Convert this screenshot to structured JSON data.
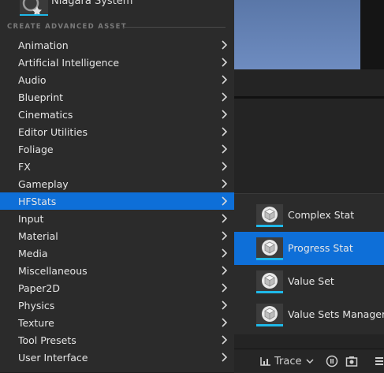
{
  "top_item": {
    "label": "Niagara System"
  },
  "section": {
    "header": "CREATE ADVANCED ASSET"
  },
  "menu_items": [
    {
      "label": "Animation"
    },
    {
      "label": "Artificial Intelligence"
    },
    {
      "label": "Audio"
    },
    {
      "label": "Blueprint"
    },
    {
      "label": "Cinematics"
    },
    {
      "label": "Editor Utilities"
    },
    {
      "label": "Foliage"
    },
    {
      "label": "FX"
    },
    {
      "label": "Gameplay"
    },
    {
      "label": "HFStats",
      "selected": true
    },
    {
      "label": "Input"
    },
    {
      "label": "Material"
    },
    {
      "label": "Media"
    },
    {
      "label": "Miscellaneous"
    },
    {
      "label": "Paper2D"
    },
    {
      "label": "Physics"
    },
    {
      "label": "Texture"
    },
    {
      "label": "Tool Presets"
    },
    {
      "label": "User Interface"
    }
  ],
  "submenu_items": [
    {
      "label": "Complex Stat",
      "icon": "cube-icon"
    },
    {
      "label": "Progress Stat",
      "icon": "cube-icon",
      "selected": true
    },
    {
      "label": "Value Set",
      "icon": "cube-icon"
    },
    {
      "label": "Value Sets Manager",
      "icon": "cube-icon"
    }
  ],
  "toolbar": {
    "trace_label": "Trace"
  },
  "colors": {
    "selection": "#0e6fd8",
    "accent_underline": "#1fb8e8",
    "menu_bg": "#2b2b2b"
  }
}
